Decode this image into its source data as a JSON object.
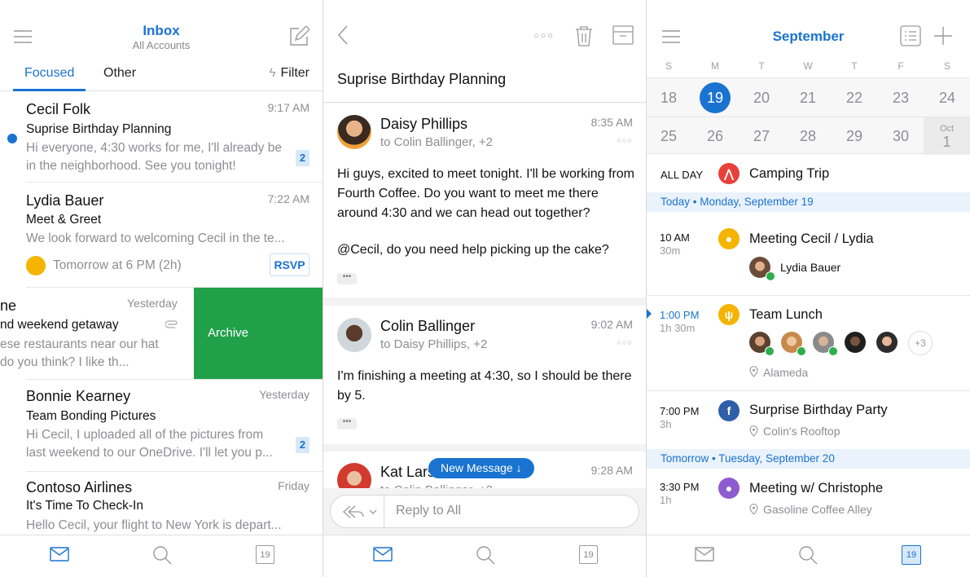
{
  "inbox": {
    "title": "Inbox",
    "subtitle": "All Accounts",
    "tabs": {
      "focused": "Focused",
      "other": "Other",
      "filter": "Filter"
    },
    "messages": [
      {
        "from": "Cecil Folk",
        "time": "9:17 AM",
        "subject": "Suprise Birthday Planning",
        "preview": "Hi everyone, 4:30 works for me, I'll already be in the neighborhood. See you tonight!",
        "badge": "2",
        "unread": true
      },
      {
        "from": "Lydia Bauer",
        "time": "7:22 AM",
        "subject": "Meet & Greet",
        "preview": "We look forward to welcoming Cecil in the te...",
        "event": "Tomorrow at 6 PM (2h)",
        "rsvp": "RSVP"
      },
      {
        "from": "ne",
        "time": "Yesterday",
        "subject": "nd weekend getaway",
        "preview": "ese restaurants near our hat do you think? I like th...",
        "swipe_action": "Archive"
      },
      {
        "from": "Bonnie Kearney",
        "time": "Yesterday",
        "subject": "Team Bonding Pictures",
        "preview": "Hi Cecil, I uploaded all of the pictures from last weekend to our OneDrive. I'll let you p...",
        "badge": "2"
      },
      {
        "from": "Contoso Airlines",
        "time": "Friday",
        "subject": "It's Time To Check-In",
        "preview": "Hello Cecil, your flight to New York is depart..."
      }
    ],
    "tabbar": {
      "calendar_day": "19"
    }
  },
  "conversation": {
    "subject": "Suprise Birthday Planning",
    "messages": [
      {
        "from": "Daisy Phillips",
        "to": "to Colin Ballinger, +2",
        "time": "8:35 AM",
        "body1": "Hi guys, excited to meet tonight. I'll be working from Fourth Coffee. Do you want to meet me there around 4:30 and we can head out together?",
        "body2_mention": "@Cecil",
        "body2_rest": ", do you need help picking up the cake?"
      },
      {
        "from": "Colin Ballinger",
        "to": "to Daisy Phillips, +2",
        "time": "9:02 AM",
        "body1": "I'm finishing a meeting at 4:30, so I should be there by 5."
      },
      {
        "from": "Kat Lars",
        "to": "to Colin Ballinger, +2",
        "time": "9:28 AM"
      }
    ],
    "new_message_pill": "New Message ↓",
    "reply_placeholder": "Reply to All",
    "tabbar": {
      "calendar_day": "19"
    }
  },
  "calendar": {
    "month": "September",
    "weekdays": [
      "S",
      "M",
      "T",
      "W",
      "T",
      "F",
      "S"
    ],
    "week1": [
      "18",
      "19",
      "20",
      "21",
      "22",
      "23",
      "24"
    ],
    "week2": [
      "25",
      "26",
      "27",
      "28",
      "29",
      "30"
    ],
    "oct_label": "Oct",
    "oct_day": "1",
    "allday": {
      "label": "ALL DAY",
      "title": "Camping Trip"
    },
    "today_band": "Today • Monday, September 19",
    "events_today": [
      {
        "time": "10 AM",
        "duration": "30m",
        "title": "Meeting Cecil / Lydia",
        "person": "Lydia Bauer",
        "color": "#f4b400"
      },
      {
        "time": "1:00 PM",
        "duration": "1h 30m",
        "title": "Team Lunch",
        "more": "+3",
        "location": "Alameda",
        "color": "#f4b400"
      },
      {
        "time": "7:00 PM",
        "duration": "3h",
        "title": "Surprise Birthday Party",
        "location": "Colin's Rooftop",
        "color": "#2f5fa7"
      }
    ],
    "tomorrow_band": "Tomorrow • Tuesday, September 20",
    "events_tomorrow": [
      {
        "time": "3:30 PM",
        "duration": "1h",
        "title": "Meeting w/ Christophe",
        "location": "Gasoline Coffee Alley",
        "color": "#8e5bd0"
      }
    ],
    "tabbar": {
      "calendar_day": "19"
    },
    "colors": {
      "accent": "#1a73d0",
      "archive_green": "#21a04a",
      "camping_red": "#e8403a"
    }
  }
}
